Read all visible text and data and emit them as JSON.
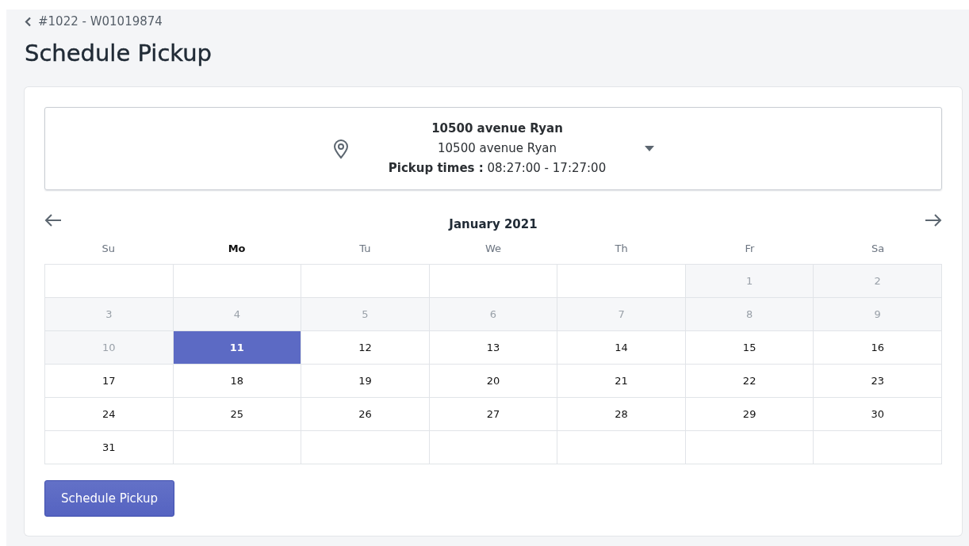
{
  "breadcrumb": {
    "label": "#1022 - W01019874"
  },
  "title": "Schedule Pickup",
  "location": {
    "name": "10500 avenue Ryan",
    "address": "10500 avenue Ryan",
    "times_label": "Pickup times :",
    "times": "08:27:00 - 17:27:00"
  },
  "calendar": {
    "month": "January 2021",
    "weekdays": [
      {
        "label": "Su",
        "selected": false
      },
      {
        "label": "Mo",
        "selected": true
      },
      {
        "label": "Tu",
        "selected": false
      },
      {
        "label": "We",
        "selected": false
      },
      {
        "label": "Th",
        "selected": false
      },
      {
        "label": "Fr",
        "selected": false
      },
      {
        "label": "Sa",
        "selected": false
      }
    ],
    "weeks": [
      [
        {
          "kind": "blank"
        },
        {
          "kind": "blank"
        },
        {
          "kind": "blank"
        },
        {
          "kind": "blank"
        },
        {
          "kind": "blank"
        },
        {
          "day": "1",
          "disabled": true,
          "selected": false
        },
        {
          "day": "2",
          "disabled": true,
          "selected": false
        }
      ],
      [
        {
          "day": "3",
          "disabled": true,
          "selected": false
        },
        {
          "day": "4",
          "disabled": true,
          "selected": false
        },
        {
          "day": "5",
          "disabled": true,
          "selected": false
        },
        {
          "day": "6",
          "disabled": true,
          "selected": false
        },
        {
          "day": "7",
          "disabled": true,
          "selected": false
        },
        {
          "day": "8",
          "disabled": true,
          "selected": false
        },
        {
          "day": "9",
          "disabled": true,
          "selected": false
        }
      ],
      [
        {
          "day": "10",
          "disabled": true,
          "selected": false
        },
        {
          "day": "11",
          "disabled": false,
          "selected": true
        },
        {
          "day": "12",
          "disabled": false,
          "selected": false
        },
        {
          "day": "13",
          "disabled": false,
          "selected": false
        },
        {
          "day": "14",
          "disabled": false,
          "selected": false
        },
        {
          "day": "15",
          "disabled": false,
          "selected": false
        },
        {
          "day": "16",
          "disabled": false,
          "selected": false
        }
      ],
      [
        {
          "day": "17",
          "disabled": false,
          "selected": false
        },
        {
          "day": "18",
          "disabled": false,
          "selected": false
        },
        {
          "day": "19",
          "disabled": false,
          "selected": false
        },
        {
          "day": "20",
          "disabled": false,
          "selected": false
        },
        {
          "day": "21",
          "disabled": false,
          "selected": false
        },
        {
          "day": "22",
          "disabled": false,
          "selected": false
        },
        {
          "day": "23",
          "disabled": false,
          "selected": false
        }
      ],
      [
        {
          "day": "24",
          "disabled": false,
          "selected": false
        },
        {
          "day": "25",
          "disabled": false,
          "selected": false
        },
        {
          "day": "26",
          "disabled": false,
          "selected": false
        },
        {
          "day": "27",
          "disabled": false,
          "selected": false
        },
        {
          "day": "28",
          "disabled": false,
          "selected": false
        },
        {
          "day": "29",
          "disabled": false,
          "selected": false
        },
        {
          "day": "30",
          "disabled": false,
          "selected": false
        }
      ],
      [
        {
          "day": "31",
          "disabled": false,
          "selected": false
        },
        {
          "kind": "blank"
        },
        {
          "kind": "blank"
        },
        {
          "kind": "blank"
        },
        {
          "kind": "blank"
        },
        {
          "kind": "blank"
        },
        {
          "kind": "blank"
        }
      ]
    ]
  },
  "button": "Schedule Pickup"
}
